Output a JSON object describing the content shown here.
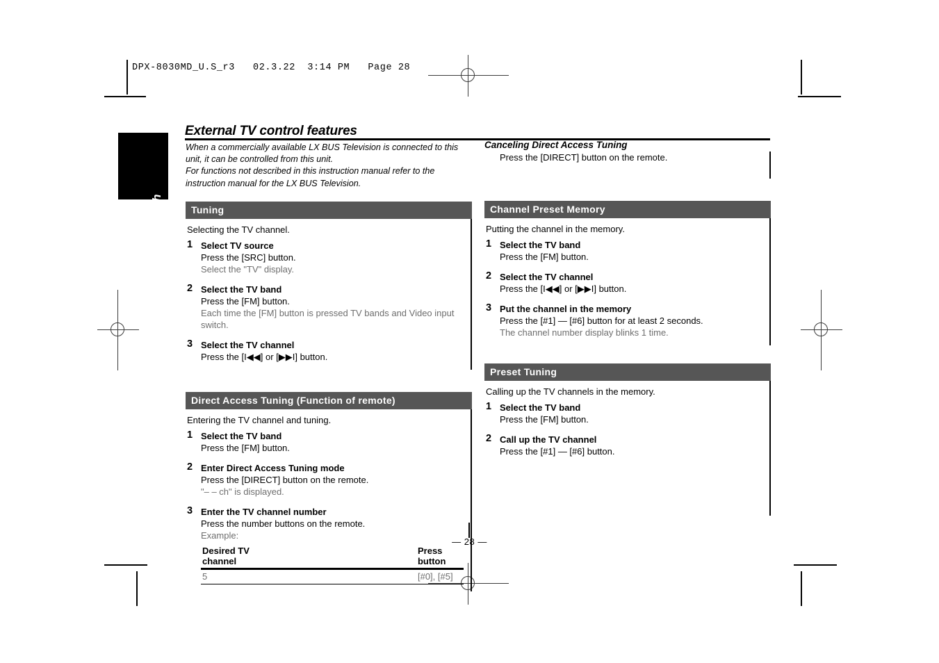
{
  "printer_header": "DPX-8030MD_U.S_r3   02.3.22  3:14 PM   Page 28",
  "side_tab": {
    "label": "English"
  },
  "page": {
    "title": "External TV control features",
    "intro": "When a commercially available LX BUS Television is connected to this unit, it can be controlled from this unit.\nFor functions not described in this instruction manual refer to the instruction manual for the LX BUS Television.",
    "page_number": "— 28 —"
  },
  "left_column": {
    "tuning": {
      "bar": "Tuning",
      "lead": "Selecting the TV channel.",
      "steps": [
        {
          "num": "1",
          "head": "Select TV source",
          "line1": "Press the [SRC] button.",
          "line2": "Select the \"TV\" display."
        },
        {
          "num": "2",
          "head": "Select the TV band",
          "line1": "Press the [FM] button.",
          "line2": "Each time the [FM] button is pressed TV bands and Video input switch."
        },
        {
          "num": "3",
          "head": "Select the TV channel",
          "line1": "Press the [I◀◀] or [▶▶I] button.",
          "line2": ""
        }
      ]
    },
    "direct_access": {
      "bar": "Direct Access Tuning (Function of remote)",
      "lead": "Entering the TV channel and tuning.",
      "steps": [
        {
          "num": "1",
          "head": "Select the TV band",
          "line1": "Press the [FM] button.",
          "line2": ""
        },
        {
          "num": "2",
          "head": "Enter Direct Access Tuning mode",
          "line1": "Press the [DIRECT] button on the remote.",
          "line2": "\"– – ch\" is displayed."
        },
        {
          "num": "3",
          "head": "Enter the TV channel number",
          "line1": "Press the number buttons on the remote.",
          "line2": "Example:"
        }
      ],
      "table": {
        "headers": [
          "Desired TV channel",
          "Press button"
        ],
        "rows": [
          [
            "5",
            "[#0], [#5]"
          ]
        ]
      }
    }
  },
  "right_column": {
    "canceling": {
      "head": "Canceling Direct Access Tuning",
      "body": "Press the [DIRECT] button on the remote."
    },
    "channel_preset_memory": {
      "bar": "Channel Preset Memory",
      "lead": "Putting the channel in the memory.",
      "steps": [
        {
          "num": "1",
          "head": "Select the TV band",
          "line1": "Press the [FM] button.",
          "line2": ""
        },
        {
          "num": "2",
          "head": "Select the TV channel",
          "line1": "Press the [I◀◀] or [▶▶I] button.",
          "line2": ""
        },
        {
          "num": "3",
          "head": "Put the channel in the memory",
          "line1": "Press the [#1] — [#6] button for at least 2 seconds.",
          "line2": "The channel number display blinks 1 time."
        }
      ]
    },
    "preset_tuning": {
      "bar": "Preset Tuning",
      "lead": "Calling up the TV channels in the memory.",
      "steps": [
        {
          "num": "1",
          "head": "Select the TV band",
          "line1": "Press the [FM] button.",
          "line2": ""
        },
        {
          "num": "2",
          "head": "Call up the TV channel",
          "line1": "Press the [#1] — [#6] button.",
          "line2": ""
        }
      ]
    }
  },
  "colors": {
    "section_bar_bg": "#565656",
    "section_bar_text": "#ffffff",
    "dim_text": "#6e6e6e",
    "rule": "#000000"
  }
}
